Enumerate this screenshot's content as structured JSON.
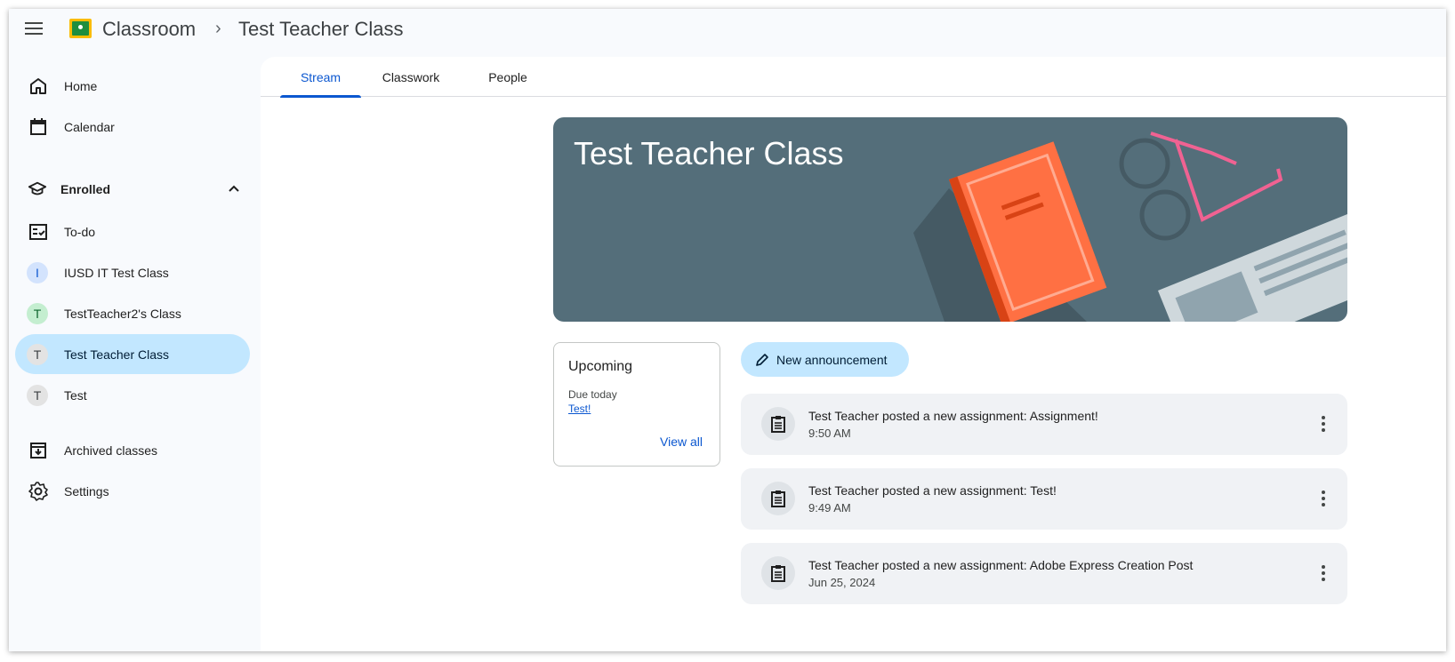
{
  "header": {
    "app_title": "Classroom",
    "breadcrumb_separator": "›",
    "class_name": "Test Teacher Class"
  },
  "sidebar": {
    "home": "Home",
    "calendar": "Calendar",
    "enrolled_label": "Enrolled",
    "todo": "To-do",
    "classes": [
      {
        "initial": "I",
        "label": "IUSD IT Test Class",
        "color": "#d3e3fd"
      },
      {
        "initial": "T",
        "label": "TestTeacher2's Class",
        "color": "#c4eed0"
      },
      {
        "initial": "T",
        "label": "Test Teacher Class",
        "color": "#e3e3e3"
      },
      {
        "initial": "T",
        "label": "Test",
        "color": "#e3e3e3"
      }
    ],
    "archived": "Archived classes",
    "settings": "Settings"
  },
  "tabs": [
    "Stream",
    "Classwork",
    "People"
  ],
  "banner": {
    "title": "Test Teacher Class",
    "background": "#546e7a"
  },
  "upcoming": {
    "heading": "Upcoming",
    "due_label": "Due today",
    "item": "Test!",
    "view_all": "View all"
  },
  "new_announcement": "New announcement",
  "posts": [
    {
      "text": "Test Teacher posted a new assignment: Assignment!",
      "time": "9:50 AM"
    },
    {
      "text": "Test Teacher posted a new assignment: Test!",
      "time": "9:49 AM"
    },
    {
      "text": "Test Teacher posted a new assignment: Adobe Express Creation Post",
      "time": "Jun 25, 2024"
    }
  ],
  "colors": {
    "accent": "#0b57d0",
    "active_nav": "#c2e7ff",
    "book": "#ff7043"
  }
}
